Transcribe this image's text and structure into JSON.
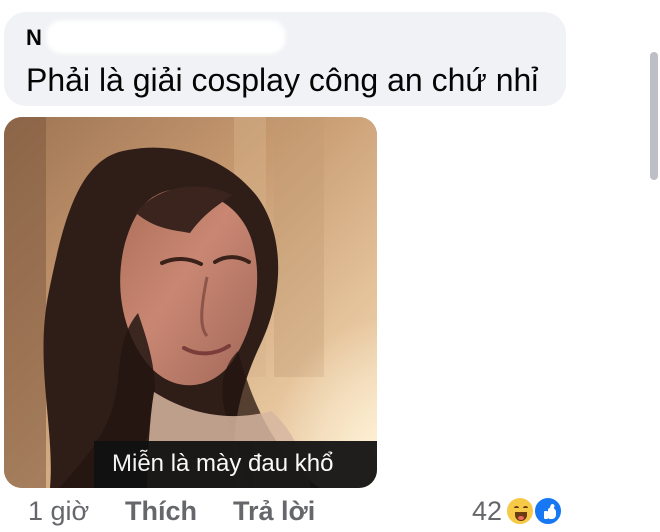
{
  "comment": {
    "author_visible": "N",
    "text": "Phải là giải cosplay công an chứ nhỉ"
  },
  "attachment": {
    "caption": "Miễn là mày đau khổ"
  },
  "actions": {
    "time": "1 giờ",
    "like": "Thích",
    "reply": "Trả lời"
  },
  "reactions": {
    "count": "42",
    "icons": [
      "haha-icon",
      "like-icon"
    ]
  },
  "colors": {
    "bubble": "#f0f2f5",
    "secondary_text": "#65676b",
    "like_blue": "#1877f2",
    "haha_yellow": "#f6c947"
  }
}
